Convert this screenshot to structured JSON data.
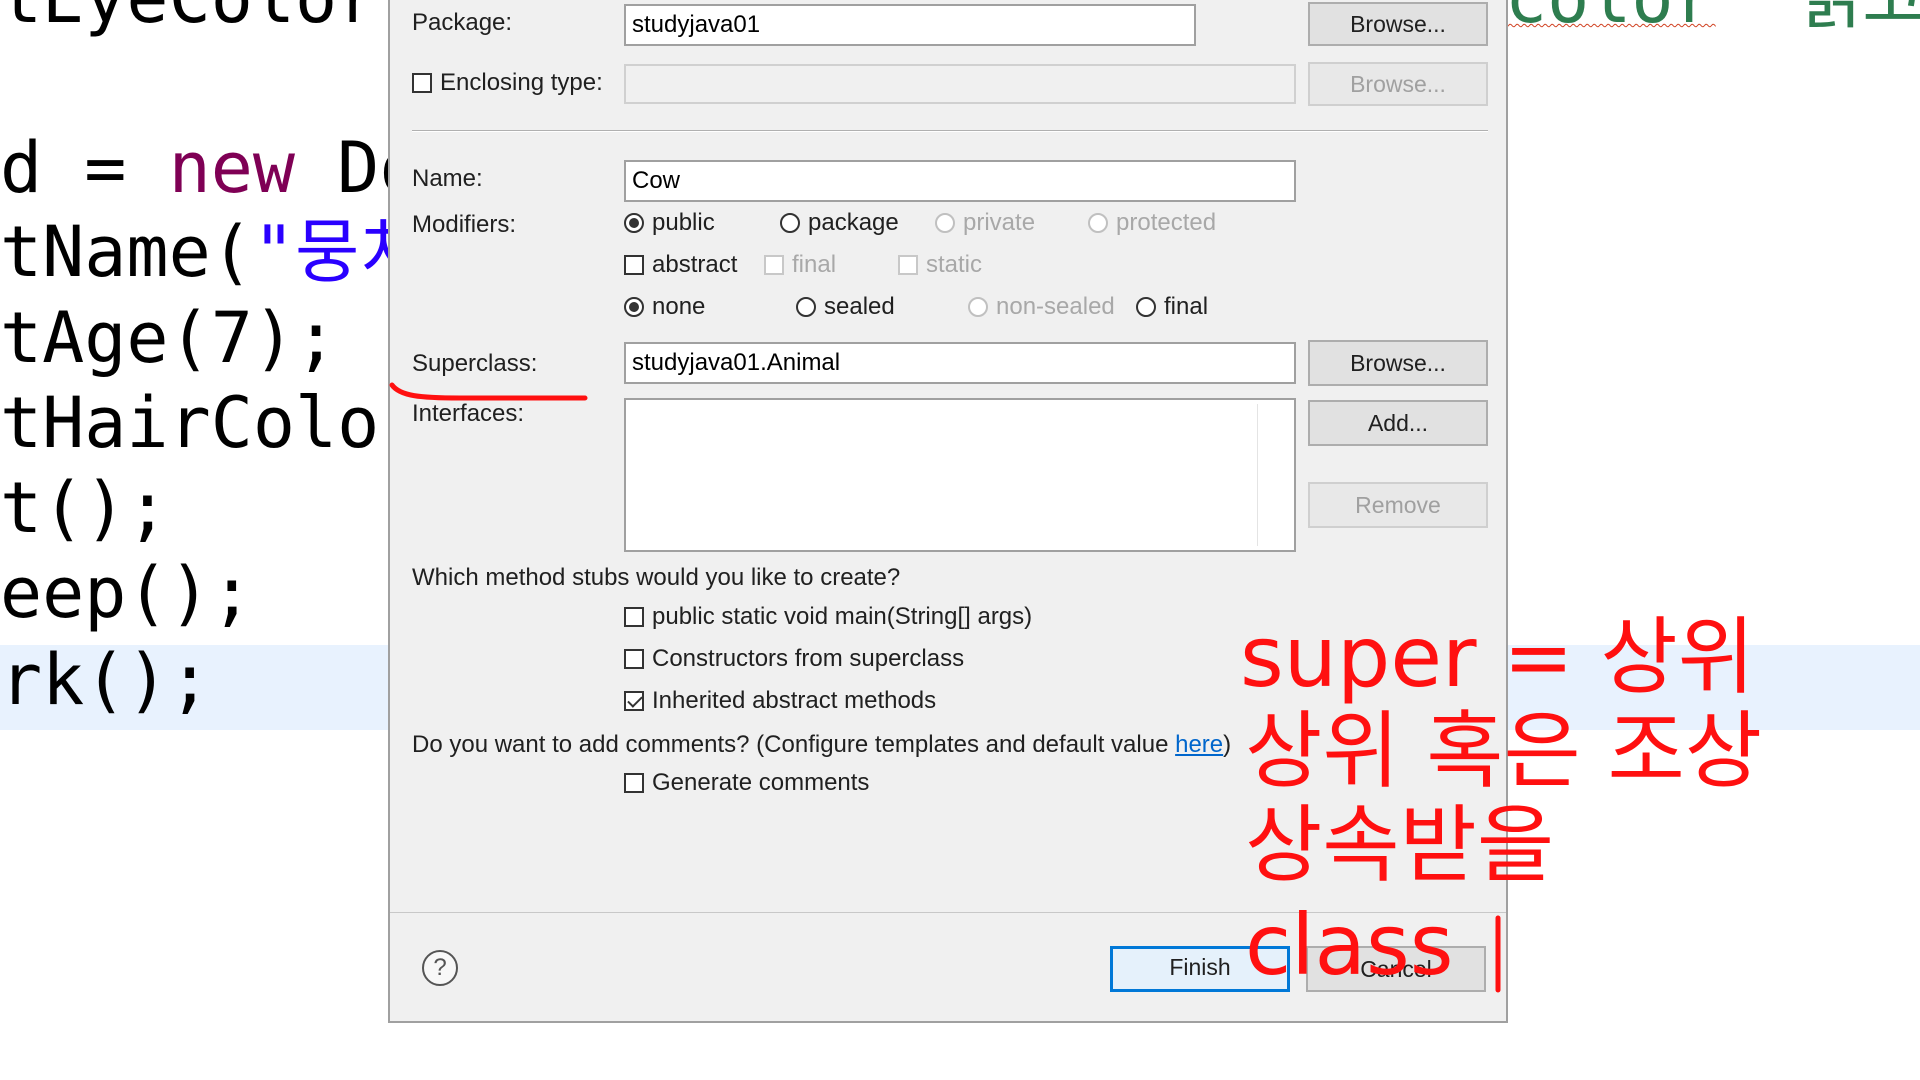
{
  "editor": {
    "lines": [
      {
        "id": "line1",
        "parts": [
          {
            "t": "tEyeColor(",
            "c": ""
          }
        ]
      },
      {
        "id": "line2",
        "parts": [
          {
            "t": "d = ",
            "c": ""
          },
          {
            "t": "new",
            "c": "kw"
          },
          {
            "t": " Dog",
            "c": ""
          }
        ]
      },
      {
        "id": "line3",
        "parts": [
          {
            "t": "tName(",
            "c": ""
          },
          {
            "t": "\"뭉치",
            "c": "str"
          }
        ]
      },
      {
        "id": "line4",
        "parts": [
          {
            "t": "tAge(7);",
            "c": ""
          }
        ]
      },
      {
        "id": "line5",
        "parts": [
          {
            "t": "tHairColor",
            "c": ""
          }
        ]
      },
      {
        "id": "line6",
        "parts": [
          {
            "t": "t();",
            "c": ""
          }
        ]
      },
      {
        "id": "line7",
        "parts": [
          {
            "t": "eep();",
            "c": ""
          }
        ]
      },
      {
        "id": "line8",
        "parts": [
          {
            "t": "rk();",
            "c": ""
          }
        ]
      }
    ],
    "right_fragment_code": "color",
    "right_fragment_korean": "읽고"
  },
  "dialog": {
    "package_label": "Package:",
    "package_value": "studyjava01",
    "browse_label": "Browse...",
    "enclosing_label": "Enclosing type:",
    "name_label": "Name:",
    "name_value": "Cow",
    "modifiers_label": "Modifiers:",
    "access_modifiers": [
      {
        "label": "public",
        "checked": true,
        "enabled": true
      },
      {
        "label": "package",
        "checked": false,
        "enabled": true
      },
      {
        "label": "private",
        "checked": false,
        "enabled": false
      },
      {
        "label": "protected",
        "checked": false,
        "enabled": false
      }
    ],
    "other_modifiers": [
      {
        "label": "abstract",
        "checked": false,
        "enabled": true
      },
      {
        "label": "final",
        "checked": false,
        "enabled": false
      },
      {
        "label": "static",
        "checked": false,
        "enabled": false
      }
    ],
    "sealing_modifiers": [
      {
        "label": "none",
        "checked": true,
        "enabled": true
      },
      {
        "label": "sealed",
        "checked": false,
        "enabled": true
      },
      {
        "label": "non-sealed",
        "checked": false,
        "enabled": false
      },
      {
        "label": "final",
        "checked": false,
        "enabled": true
      }
    ],
    "superclass_label": "Superclass:",
    "superclass_value": "studyjava01.Animal",
    "interfaces_label": "Interfaces:",
    "add_label": "Add...",
    "remove_label": "Remove",
    "stubs_question": "Which method stubs would you like to create?",
    "stubs": [
      {
        "label": "public static void main(String[] args)",
        "checked": false
      },
      {
        "label": "Constructors from superclass",
        "checked": false
      },
      {
        "label": "Inherited abstract methods",
        "checked": true
      }
    ],
    "comments_question": "Do you want to add comments? (Configure templates and default value ",
    "comments_link": "here",
    "comments_close": ")",
    "generate_comments_label": "Generate comments",
    "generate_comments_checked": false,
    "help_symbol": "?",
    "finish_label": "Finish",
    "cancel_label": "Cancel"
  },
  "annotations": {
    "line1": "super = 상위",
    "line2": "상위 혹은 조상",
    "line3": "상속받을",
    "line4": "class",
    "color": "#ff1010"
  },
  "colors": {
    "keyword": "#7f0055",
    "string": "#2a00ff",
    "current_line": "#e8f2fe",
    "default_button_border": "#0078d7",
    "link": "#0066cc"
  }
}
